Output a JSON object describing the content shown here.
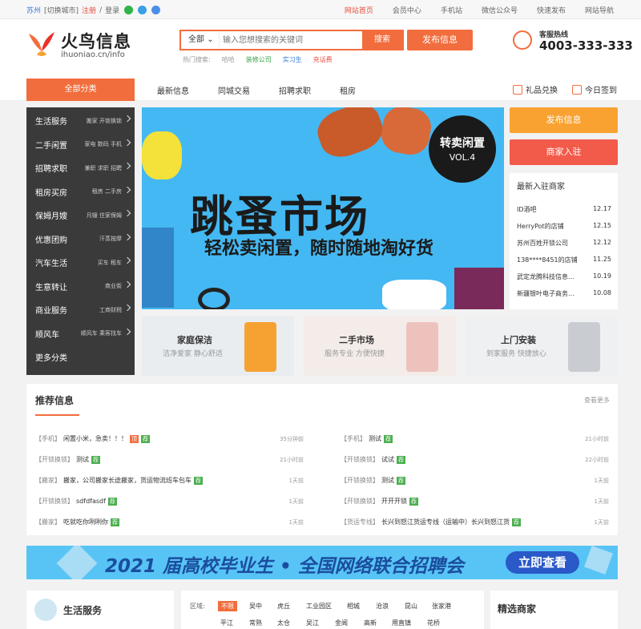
{
  "topbar": {
    "city": "苏州",
    "switch_city": "[切换城市]",
    "register": "注册",
    "slash": "/",
    "login": "登录",
    "links": [
      "网站首页",
      "会员中心",
      "手机站",
      "微信公众号",
      "快速发布",
      "网站导航"
    ]
  },
  "header": {
    "logo_name": "火鸟信息",
    "logo_domain": "ihuoniao.cn/info",
    "search_select": "全部",
    "search_placeholder": "输入您想搜索的关键词",
    "search_button": "搜索",
    "publish_button": "发布信息",
    "hot_label": "热门搜索:",
    "hot_words": [
      "哈哈",
      "装修公司",
      "实习生",
      "充话费"
    ],
    "hotline_label": "客服热线",
    "hotline_number": "4003-333-333"
  },
  "nav": {
    "all_categories": "全部分类",
    "links": [
      "最新信息",
      "同城交易",
      "招聘求职",
      "租房"
    ],
    "gift": "礼品兑换",
    "checkin": "今日签到"
  },
  "sidebar": {
    "items": [
      {
        "main": "生活服务",
        "sub": "搬家 开锁换锁"
      },
      {
        "main": "二手闲置",
        "sub": "家电 数码 手机"
      },
      {
        "main": "招聘求职",
        "sub": "兼职 求职 招聘"
      },
      {
        "main": "租房买房",
        "sub": "租房 二手房"
      },
      {
        "main": "保姆月嫂",
        "sub": "月嫂 住家保姆"
      },
      {
        "main": "优惠团购",
        "sub": "汗蒸按摩"
      },
      {
        "main": "汽车生活",
        "sub": "买车 租车"
      },
      {
        "main": "生意转让",
        "sub": "商业街"
      },
      {
        "main": "商业服务",
        "sub": "工商财税"
      },
      {
        "main": "顺风车",
        "sub": "顺风车 乘客找车"
      },
      {
        "main": "更多分类",
        "sub": ""
      }
    ]
  },
  "banner": {
    "title": "跳蚤市场",
    "subtitle": "轻松卖闲置，随时随地淘好货",
    "badge_line1": "转卖闲置",
    "badge_line2": "VOL.4"
  },
  "right_col": {
    "publish": "发布信息",
    "merchant_join": "商家入驻",
    "new_merchants_title": "最新入驻商家",
    "merchants": [
      {
        "name": "ID酒吧",
        "date": "12.17"
      },
      {
        "name": "HerryPot的店铺",
        "date": "12.15"
      },
      {
        "name": "苏州百姓开锁公司",
        "date": "12.12"
      },
      {
        "name": "138****8451的店铺",
        "date": "11.25"
      },
      {
        "name": "武定龙腾科技信息...",
        "date": "10.19"
      },
      {
        "name": "新疆银叶电子商务...",
        "date": "10.08"
      }
    ]
  },
  "cards": [
    {
      "title": "家庭保洁",
      "sub": "洁净爱家 静心舒适"
    },
    {
      "title": "二手市场",
      "sub": "服务专业 方便快捷"
    },
    {
      "title": "上门安装",
      "sub": "到家服务 快捷放心"
    }
  ],
  "recommend": {
    "title": "推荐信息",
    "more": "查看更多",
    "left": [
      {
        "tag": "【手机】",
        "text": "闲置小米，急卖！！！",
        "marks": [
          "顶",
          "荐"
        ],
        "time": "35分钟前"
      },
      {
        "tag": "【开锁换锁】",
        "text": "测试",
        "marks": [
          "荐"
        ],
        "time": "21小时前"
      },
      {
        "tag": "【搬家】",
        "text": "搬家，公司搬家长途搬家，货运物流班车包车",
        "marks": [
          "荐"
        ],
        "time": "1天前"
      },
      {
        "tag": "【开锁换锁】",
        "text": "sdfdfasdf",
        "marks": [
          "荐"
        ],
        "time": "1天前"
      },
      {
        "tag": "【搬家】",
        "text": "吃就吃你咧咧你",
        "marks": [
          "荐"
        ],
        "time": "1天前"
      }
    ],
    "right": [
      {
        "tag": "【手机】",
        "text": "测试",
        "marks": [
          "荐"
        ],
        "time": "21小时前"
      },
      {
        "tag": "【开锁换锁】",
        "text": "试试",
        "marks": [
          "荐"
        ],
        "time": "22小时前"
      },
      {
        "tag": "【开锁换锁】",
        "text": "测试",
        "marks": [
          "荐"
        ],
        "time": "1天前"
      },
      {
        "tag": "【开锁换锁】",
        "text": "开开开锁",
        "marks": [
          "荐"
        ],
        "time": "1天前"
      },
      {
        "tag": "【货运专线】",
        "text": "长兴到怒江货运专线（运输中）长兴到怒江货",
        "marks": [
          "荐"
        ],
        "time": "1天前"
      }
    ]
  },
  "ad": {
    "text": "2021 届高校毕业生 • 全国网络联合招聘会",
    "button": "立即查看"
  },
  "bottom": {
    "life_title": "生活服务",
    "area_label": "区域:",
    "areas_row1": [
      "不限",
      "吴中",
      "虎丘",
      "工业园区",
      "相城",
      "沧浪",
      "昆山",
      "张家港"
    ],
    "areas_row2": [
      "平江",
      "常熟",
      "太仓",
      "吴江",
      "金阊",
      "高新",
      "用直镇",
      "花桥"
    ],
    "featured_title": "精选商家"
  },
  "colors": {
    "accent": "#f26d3d",
    "sidebar_bg": "#3a3a3a",
    "tag_top": "#f26d3d",
    "tag_rec": "#4caf50"
  }
}
